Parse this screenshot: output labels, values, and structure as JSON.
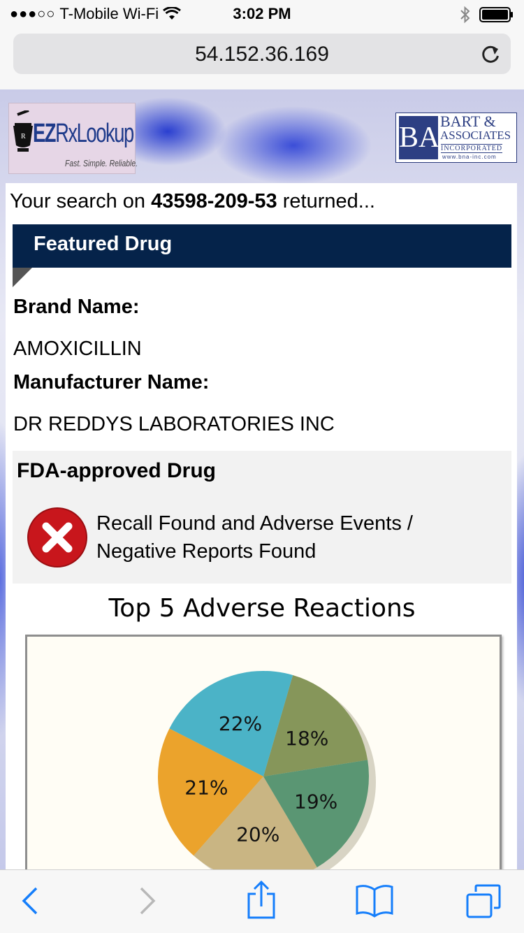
{
  "status_bar": {
    "signal_dots": "●●●○○",
    "carrier": "T-Mobile Wi-Fi",
    "time": "3:02 PM"
  },
  "browser": {
    "url": "54.152.36.169"
  },
  "header": {
    "left_logo": {
      "ez": "EZ",
      "rx": "Rx",
      "lookup": "Lookup",
      "tagline": "Fast. Simple. Reliable."
    },
    "right_logo": {
      "mark": "BA",
      "line1": "BART &",
      "line2": "ASSOCIATES",
      "line3": "INCORPORATED",
      "web": "www.bna-inc.com"
    }
  },
  "search": {
    "prefix": "Your search on ",
    "code": "43598-209-53",
    "suffix": " returned..."
  },
  "featured": {
    "title": "Featured Drug",
    "brand_label": "Brand Name:",
    "brand_value": "AMOXICILLIN",
    "manufacturer_label": "Manufacturer Name:",
    "manufacturer_value": "DR REDDYS LABORATORIES INC"
  },
  "fda": {
    "title": "FDA-approved Drug",
    "message_line1": "Recall Found and Adverse Events /",
    "message_line2": "Negative Reports Found"
  },
  "chart_data": {
    "type": "pie",
    "title": "Top 5 Adverse Reactions",
    "values": [
      18,
      22,
      21,
      20,
      19
    ],
    "labels": [
      "18%",
      "22%",
      "21%",
      "20%",
      "19%"
    ],
    "colors": [
      "#86965a",
      "#4bb3c7",
      "#eba32c",
      "#c9b583",
      "#5a9673"
    ]
  },
  "colors": {
    "featured_bar": "#05234a",
    "error_red": "#c8161c",
    "ios_blue": "#157efb"
  }
}
